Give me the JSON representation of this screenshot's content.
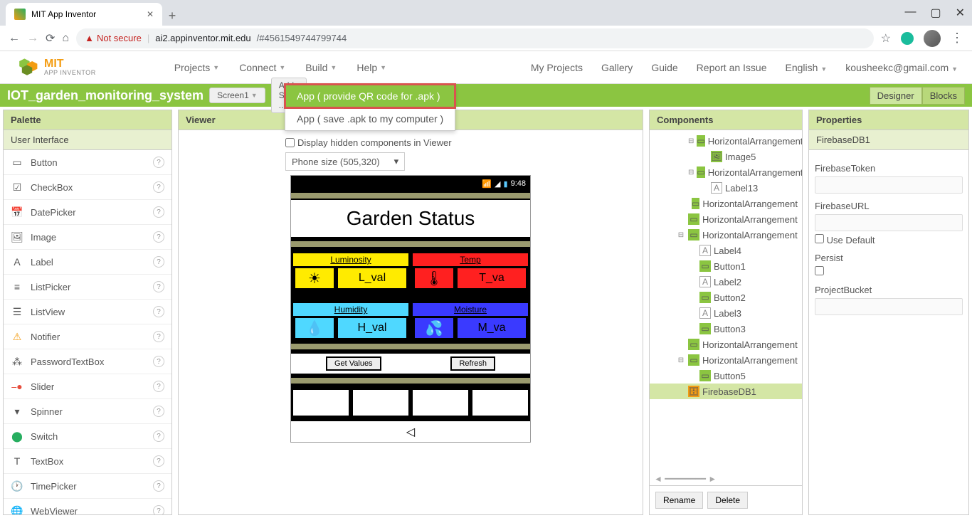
{
  "browser": {
    "tab_title": "MIT App Inventor",
    "not_secure": "Not secure",
    "url_host": "ai2.appinventor.mit.edu",
    "url_path": "/#4561549744799744"
  },
  "logo": {
    "main": "MIT",
    "sub": "APP INVENTOR"
  },
  "menu": {
    "projects": "Projects",
    "connect": "Connect",
    "build": "Build",
    "help": "Help"
  },
  "right_menu": {
    "my_projects": "My Projects",
    "gallery": "Gallery",
    "guide": "Guide",
    "report": "Report an Issue",
    "language": "English",
    "user": "kousheekc@gmail.com"
  },
  "toolbar": {
    "project_name": "IOT_garden_monitoring_system",
    "screen": "Screen1",
    "add_screen": "Add Screen ...",
    "designer": "Designer",
    "blocks": "Blocks"
  },
  "build_dropdown": {
    "qr": "App ( provide QR code for .apk )",
    "save": "App ( save .apk to my computer )"
  },
  "palette": {
    "title": "Palette",
    "category": "User Interface",
    "items": [
      "Button",
      "CheckBox",
      "DatePicker",
      "Image",
      "Label",
      "ListPicker",
      "ListView",
      "Notifier",
      "PasswordTextBox",
      "Slider",
      "Spinner",
      "Switch",
      "TextBox",
      "TimePicker",
      "WebViewer"
    ]
  },
  "viewer": {
    "title": "Viewer",
    "hidden_label": "Display hidden components in Viewer",
    "size": "Phone size (505,320)",
    "status_time": "9:48",
    "garden_title": "Garden Status",
    "luminosity": "Luminosity",
    "l_val": "L_val",
    "temp": "Temp",
    "t_val": "T_va",
    "humidity": "Humidity",
    "h_val": "H_val",
    "moisture": "Moisture",
    "m_val": "M_va",
    "get_values": "Get Values",
    "refresh": "Refresh"
  },
  "components": {
    "title": "Components",
    "items": [
      {
        "name": "HorizontalArrangement",
        "indent": 3,
        "icon": "horiz",
        "expand": "⊟"
      },
      {
        "name": "Image5",
        "indent": 4,
        "icon": "img"
      },
      {
        "name": "HorizontalArrangement",
        "indent": 3,
        "icon": "horiz",
        "expand": "⊟"
      },
      {
        "name": "Label13",
        "indent": 4,
        "icon": "label"
      },
      {
        "name": "HorizontalArrangement",
        "indent": 3,
        "icon": "horiz"
      },
      {
        "name": "HorizontalArrangement",
        "indent": 2,
        "icon": "horiz"
      },
      {
        "name": "HorizontalArrangement",
        "indent": 2,
        "icon": "horiz",
        "expand": "⊟"
      },
      {
        "name": "Label4",
        "indent": 3,
        "icon": "label"
      },
      {
        "name": "Button1",
        "indent": 3,
        "icon": "btn"
      },
      {
        "name": "Label2",
        "indent": 3,
        "icon": "label"
      },
      {
        "name": "Button2",
        "indent": 3,
        "icon": "btn"
      },
      {
        "name": "Label3",
        "indent": 3,
        "icon": "label"
      },
      {
        "name": "Button3",
        "indent": 3,
        "icon": "btn"
      },
      {
        "name": "HorizontalArrangement",
        "indent": 2,
        "icon": "horiz"
      },
      {
        "name": "HorizontalArrangement",
        "indent": 2,
        "icon": "horiz",
        "expand": "⊟"
      },
      {
        "name": "Button5",
        "indent": 3,
        "icon": "btn"
      },
      {
        "name": "FirebaseDB1",
        "indent": 2,
        "icon": "db",
        "selected": true
      }
    ],
    "rename": "Rename",
    "delete": "Delete"
  },
  "properties": {
    "title": "Properties",
    "component": "FirebaseDB1",
    "token_label": "FirebaseToken",
    "url_label": "FirebaseURL",
    "use_default": "Use Default",
    "persist": "Persist",
    "bucket": "ProjectBucket"
  }
}
